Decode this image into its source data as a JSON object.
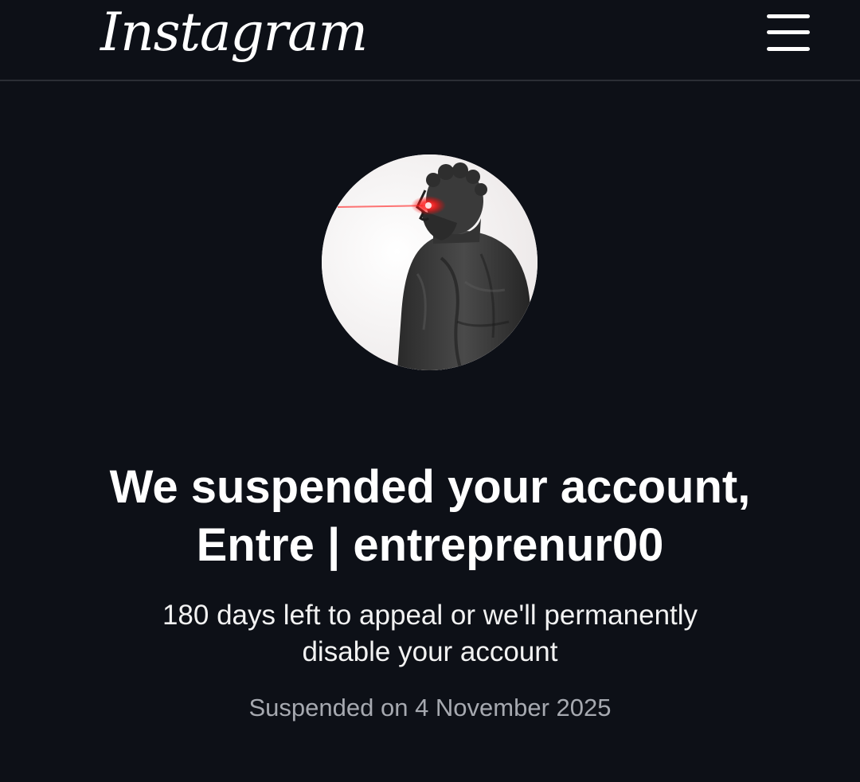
{
  "header": {
    "logo_text": "Instagram",
    "menu_icon": "hamburger-menu-icon"
  },
  "profile": {
    "avatar_description_icon": "statue-avatar-icon",
    "accent_color": "#ff2a2a"
  },
  "notice": {
    "title_line1": "We suspended your account,",
    "title_line2": "Entre | entreprenur00",
    "subtitle_line1": "180 days left to appeal or we'll permanently",
    "subtitle_line2": "disable your account",
    "suspended_date": "Suspended on 4 November 2025"
  },
  "colors": {
    "background": "#0d1017",
    "divider": "#2b2e35",
    "muted_text": "#a6a9b0"
  }
}
